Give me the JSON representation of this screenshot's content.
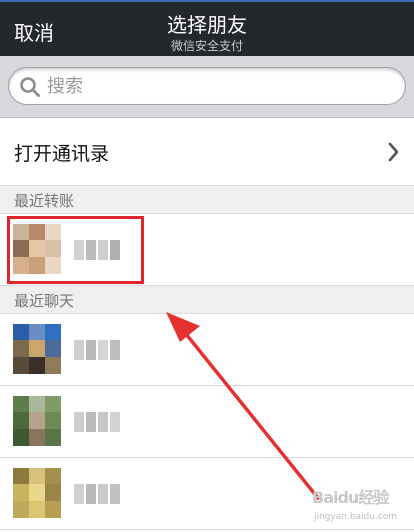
{
  "navbar": {
    "cancel_label": "取消",
    "title": "选择朋友",
    "subtitle": "微信安全支付"
  },
  "search": {
    "placeholder": "搜索"
  },
  "contacts": {
    "label": "打开通讯录",
    "icon": "chevron-right-icon"
  },
  "sections": {
    "recent_transfer": "最近转账",
    "recent_chat": "最近聊天"
  },
  "recent_transfer_items": [
    {
      "name": "",
      "avatar": "blurred-photo"
    }
  ],
  "recent_chat_items": [
    {
      "name": "",
      "avatar": "blurred-photo"
    },
    {
      "name": "",
      "avatar": "blurred-photo"
    },
    {
      "name": "",
      "avatar": "blurred-photo"
    }
  ],
  "watermark": {
    "logo_text": "Baidu经验",
    "url": "jingyan.baidu.com"
  },
  "colors": {
    "navbar_bg": "#24272c",
    "highlight": "#e0262c",
    "arrow": "#e53030",
    "section_bg": "#efefef"
  }
}
